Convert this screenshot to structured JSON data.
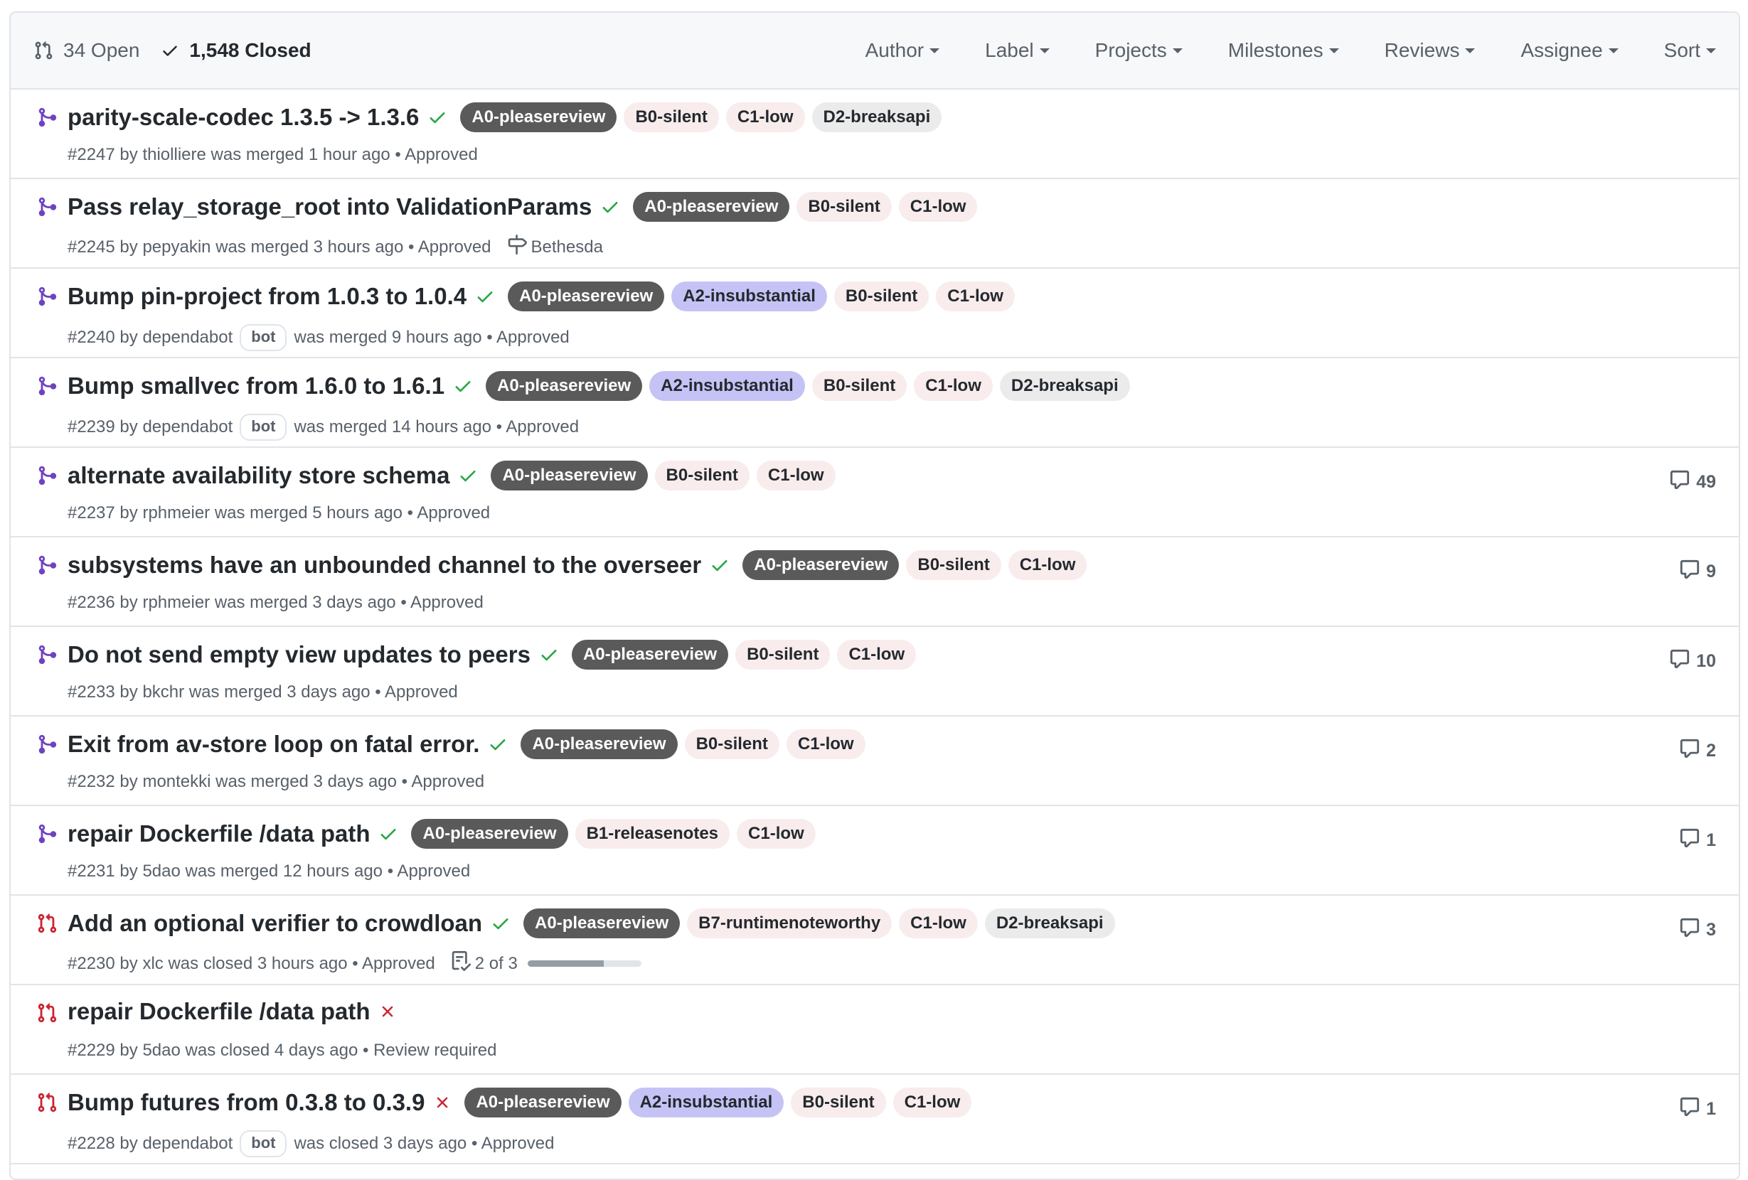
{
  "header": {
    "open_count": "34 Open",
    "closed_count": "1,548 Closed",
    "filters": [
      "Author",
      "Label",
      "Projects",
      "Milestones",
      "Reviews",
      "Assignee",
      "Sort"
    ]
  },
  "colors": {
    "merged_icon": "#6f42c1",
    "closed_icon": "#cb2431",
    "check": "#28a745",
    "cross": "#cb2431"
  },
  "pulls": [
    {
      "state": "merged",
      "check": "success",
      "title": "parity-scale-codec 1.3.5 -> 1.3.6",
      "labels": [
        {
          "name": "A0-pleasereview",
          "style": "dark"
        },
        {
          "name": "B0-silent",
          "style": "pink"
        },
        {
          "name": "C1-low",
          "style": "pink"
        },
        {
          "name": "D2-breaksapi",
          "style": "gray"
        }
      ],
      "number": "#2247",
      "by": "by",
      "author": "thiolliere",
      "bot": "",
      "action": "was merged 1 hour ago",
      "review": "• Approved",
      "milestone": "",
      "tasks": "",
      "task_progress": null,
      "comments": ""
    },
    {
      "state": "merged",
      "check": "success",
      "title": "Pass relay_storage_root into ValidationParams",
      "labels": [
        {
          "name": "A0-pleasereview",
          "style": "dark"
        },
        {
          "name": "B0-silent",
          "style": "pink"
        },
        {
          "name": "C1-low",
          "style": "pink"
        }
      ],
      "number": "#2245",
      "by": "by",
      "author": "pepyakin",
      "bot": "",
      "action": "was merged 3 hours ago",
      "review": "• Approved",
      "milestone": "Bethesda",
      "tasks": "",
      "task_progress": null,
      "comments": ""
    },
    {
      "state": "merged",
      "check": "success",
      "title": "Bump pin-project from 1.0.3 to 1.0.4",
      "labels": [
        {
          "name": "A0-pleasereview",
          "style": "dark"
        },
        {
          "name": "A2-insubstantial",
          "style": "purple"
        },
        {
          "name": "B0-silent",
          "style": "pink"
        },
        {
          "name": "C1-low",
          "style": "pink"
        }
      ],
      "number": "#2240",
      "by": "by",
      "author": "dependabot",
      "bot": "bot",
      "action": "was merged 9 hours ago",
      "review": "• Approved",
      "milestone": "",
      "tasks": "",
      "task_progress": null,
      "comments": ""
    },
    {
      "state": "merged",
      "check": "success",
      "title": "Bump smallvec from 1.6.0 to 1.6.1",
      "labels": [
        {
          "name": "A0-pleasereview",
          "style": "dark"
        },
        {
          "name": "A2-insubstantial",
          "style": "purple"
        },
        {
          "name": "B0-silent",
          "style": "pink"
        },
        {
          "name": "C1-low",
          "style": "pink"
        },
        {
          "name": "D2-breaksapi",
          "style": "gray"
        }
      ],
      "number": "#2239",
      "by": "by",
      "author": "dependabot",
      "bot": "bot",
      "action": "was merged 14 hours ago",
      "review": "• Approved",
      "milestone": "",
      "tasks": "",
      "task_progress": null,
      "comments": ""
    },
    {
      "state": "merged",
      "check": "success",
      "title": "alternate availability store schema",
      "labels": [
        {
          "name": "A0-pleasereview",
          "style": "dark"
        },
        {
          "name": "B0-silent",
          "style": "pink"
        },
        {
          "name": "C1-low",
          "style": "pink"
        }
      ],
      "number": "#2237",
      "by": "by",
      "author": "rphmeier",
      "bot": "",
      "action": "was merged 5 hours ago",
      "review": "• Approved",
      "milestone": "",
      "tasks": "",
      "task_progress": null,
      "comments": "49"
    },
    {
      "state": "merged",
      "check": "success",
      "title": "subsystems have an unbounded channel to the overseer",
      "labels": [
        {
          "name": "A0-pleasereview",
          "style": "dark"
        },
        {
          "name": "B0-silent",
          "style": "pink"
        },
        {
          "name": "C1-low",
          "style": "pink"
        }
      ],
      "number": "#2236",
      "by": "by",
      "author": "rphmeier",
      "bot": "",
      "action": "was merged 3 days ago",
      "review": "• Approved",
      "milestone": "",
      "tasks": "",
      "task_progress": null,
      "comments": "9"
    },
    {
      "state": "merged",
      "check": "success",
      "title": "Do not send empty view updates to peers",
      "labels": [
        {
          "name": "A0-pleasereview",
          "style": "dark"
        },
        {
          "name": "B0-silent",
          "style": "pink"
        },
        {
          "name": "C1-low",
          "style": "pink"
        }
      ],
      "number": "#2233",
      "by": "by",
      "author": "bkchr",
      "bot": "",
      "action": "was merged 3 days ago",
      "review": "• Approved",
      "milestone": "",
      "tasks": "",
      "task_progress": null,
      "comments": "10"
    },
    {
      "state": "merged",
      "check": "success",
      "title": "Exit from av-store loop on fatal error.",
      "labels": [
        {
          "name": "A0-pleasereview",
          "style": "dark"
        },
        {
          "name": "B0-silent",
          "style": "pink"
        },
        {
          "name": "C1-low",
          "style": "pink"
        }
      ],
      "number": "#2232",
      "by": "by",
      "author": "montekki",
      "bot": "",
      "action": "was merged 3 days ago",
      "review": "• Approved",
      "milestone": "",
      "tasks": "",
      "task_progress": null,
      "comments": "2"
    },
    {
      "state": "merged",
      "check": "success",
      "title": "repair Dockerfile /data path",
      "labels": [
        {
          "name": "A0-pleasereview",
          "style": "dark"
        },
        {
          "name": "B1-releasenotes",
          "style": "pink"
        },
        {
          "name": "C1-low",
          "style": "pink"
        }
      ],
      "number": "#2231",
      "by": "by",
      "author": "5dao",
      "bot": "",
      "action": "was merged 12 hours ago",
      "review": "• Approved",
      "milestone": "",
      "tasks": "",
      "task_progress": null,
      "comments": "1"
    },
    {
      "state": "closed",
      "check": "success",
      "title": "Add an optional verifier to crowdloan",
      "labels": [
        {
          "name": "A0-pleasereview",
          "style": "dark"
        },
        {
          "name": "B7-runtimenoteworthy",
          "style": "pink"
        },
        {
          "name": "C1-low",
          "style": "pink"
        },
        {
          "name": "D2-breaksapi",
          "style": "gray"
        }
      ],
      "number": "#2230",
      "by": "by",
      "author": "xlc",
      "bot": "",
      "action": "was closed 3 hours ago",
      "review": "• Approved",
      "milestone": "",
      "tasks": "2 of 3",
      "task_progress": 0.6667,
      "comments": "3"
    },
    {
      "state": "closed",
      "check": "failure",
      "title": "repair Dockerfile /data path",
      "labels": [],
      "number": "#2229",
      "by": "by",
      "author": "5dao",
      "bot": "",
      "action": "was closed 4 days ago",
      "review": "• Review required",
      "milestone": "",
      "tasks": "",
      "task_progress": null,
      "comments": ""
    },
    {
      "state": "closed",
      "check": "failure",
      "title": "Bump futures from 0.3.8 to 0.3.9",
      "labels": [
        {
          "name": "A0-pleasereview",
          "style": "dark"
        },
        {
          "name": "A2-insubstantial",
          "style": "purple"
        },
        {
          "name": "B0-silent",
          "style": "pink"
        },
        {
          "name": "C1-low",
          "style": "pink"
        }
      ],
      "number": "#2228",
      "by": "by",
      "author": "dependabot",
      "bot": "bot",
      "action": "was closed 3 days ago",
      "review": "• Approved",
      "milestone": "",
      "tasks": "",
      "task_progress": null,
      "comments": "1"
    }
  ]
}
